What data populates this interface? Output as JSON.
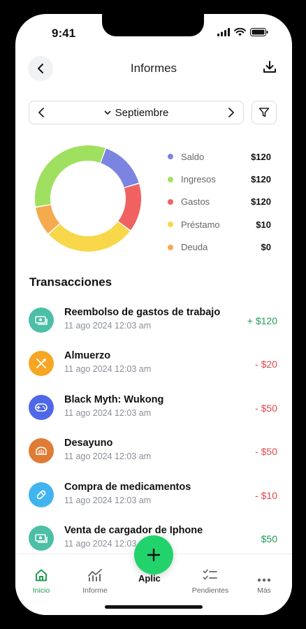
{
  "status": {
    "time": "9:41"
  },
  "header": {
    "title": "Informes"
  },
  "period": {
    "month": "Septiembre"
  },
  "colors": {
    "positive": "#1f9d55",
    "negative": "#e0474c",
    "accent": "#22d36b"
  },
  "summary": [
    {
      "name": "Saldo",
      "value": "$120",
      "color": "#7b84e0"
    },
    {
      "name": "Ingresos",
      "value": "$120",
      "color": "#a0e060"
    },
    {
      "name": "Gastos",
      "value": "$120",
      "color": "#f06262"
    },
    {
      "name": "Préstamo",
      "value": "$10",
      "color": "#f8d84a"
    },
    {
      "name": "Deuda",
      "value": "$0",
      "color": "#f5aa4e"
    }
  ],
  "donut_segments": [
    {
      "name": "Saldo",
      "share": 0.15,
      "color": "#7b84e0"
    },
    {
      "name": "Gastos",
      "share": 0.15,
      "color": "#f06262"
    },
    {
      "name": "Préstamo",
      "share": 0.28,
      "color": "#f8d84a"
    },
    {
      "name": "Deuda",
      "share": 0.09,
      "color": "#f5aa4e"
    },
    {
      "name": "Ingresos",
      "share": 0.33,
      "color": "#a0e060"
    }
  ],
  "transactions_title": "Transacciones",
  "transactions": [
    {
      "title": "Reembolso de gastos de trabajo",
      "date": "11 ago 2024 12:03 am",
      "amount": "+ $120",
      "type": "pos",
      "icon": "cash-icon",
      "icon_bg": "#4cbfa6"
    },
    {
      "title": "Almuerzo",
      "date": "11 ago 2024 12:03 am",
      "amount": "- $20",
      "type": "neg",
      "icon": "utensils-icon",
      "icon_bg": "#f5a623"
    },
    {
      "title": "Black Myth: Wukong",
      "date": "11 ago 2024 12:03 am",
      "amount": "- $50",
      "type": "neg",
      "icon": "gamepad-icon",
      "icon_bg": "#4f68e8"
    },
    {
      "title": "Desayuno",
      "date": "11 ago 2024 12:03 am",
      "amount": "- $50",
      "type": "neg",
      "icon": "bread-icon",
      "icon_bg": "#e07b36"
    },
    {
      "title": "Compra de medicamentos",
      "date": "11 ago 2024 12:03 am",
      "amount": "- $10",
      "type": "neg",
      "icon": "pill-icon",
      "icon_bg": "#3fb4ef"
    },
    {
      "title": "Venta de cargador de Iphone",
      "date": "11 ago 2024 12:03 am",
      "amount": "$50",
      "type": "pos",
      "icon": "cash-icon",
      "icon_bg": "#4cbfa6"
    }
  ],
  "tabs": {
    "home": "Inicio",
    "reports": "Informe",
    "center": "Aplic",
    "pending": "Pendientes",
    "more": "Más"
  }
}
